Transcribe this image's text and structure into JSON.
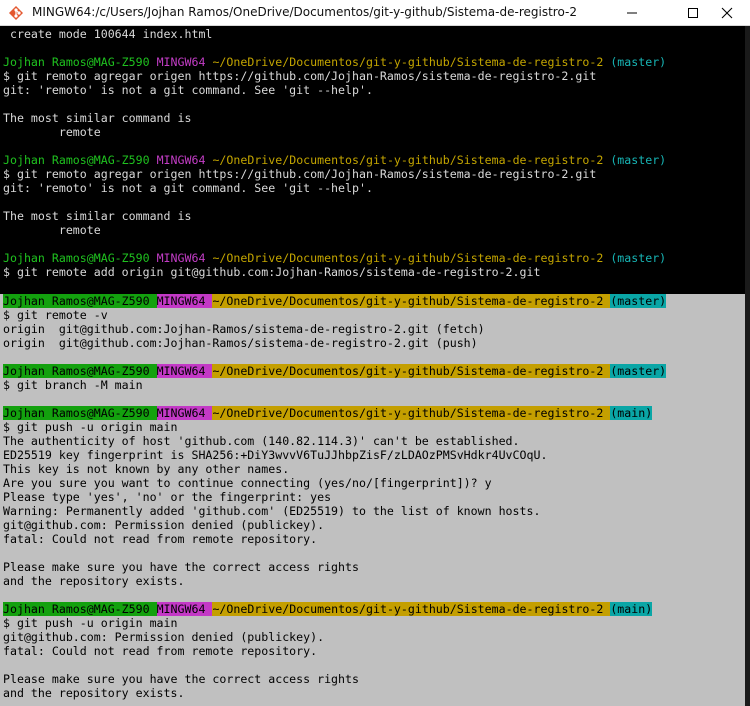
{
  "window": {
    "title": "MINGW64:/c/Users/Jojhan Ramos/OneDrive/Documentos/git-y-github/Sistema-de-registro-2"
  },
  "prompt": {
    "user": "Jojhan Ramos@MAG-Z590",
    "sys": "MINGW64",
    "path": "~/OneDrive/Documentos/git-y-github/Sistema-de-registro-2",
    "branch_master": "(master)",
    "branch_main": "(main)"
  },
  "lines": {
    "l0": " create mode 100644 index.html",
    "l2": "$ git remoto agregar origen https://github.com/Jojhan-Ramos/sistema-de-registro-2.git",
    "l3": "git: 'remoto' is not a git command. See 'git --help'.",
    "l5": "The most similar command is",
    "l6": "        remote",
    "l9": "$ git remoto agregar origen https://github.com/Jojhan-Ramos/sistema-de-registro-2.git",
    "l10": "git: 'remoto' is not a git command. See 'git --help'.",
    "l12": "The most similar command is",
    "l13": "        remote",
    "l16": "$ git remote add origin git@github.com:Jojhan-Ramos/sistema-de-registro-2.git",
    "l18": "$ git remote -v",
    "l19": "origin  git@github.com:Jojhan-Ramos/sistema-de-registro-2.git (fetch)",
    "l20": "origin  git@github.com:Jojhan-Ramos/sistema-de-registro-2.git (push)",
    "l23": "$ git branch -M main",
    "l26": "$ git push -u origin main",
    "l27": "The authenticity of host 'github.com (140.82.114.3)' can't be established.",
    "l28": "ED25519 key fingerprint is SHA256:+DiY3wvvV6TuJJhbpZisF/zLDAOzPMSvHdkr4UvCOqU.",
    "l29": "This key is not known by any other names.",
    "l30": "Are you sure you want to continue connecting (yes/no/[fingerprint])? y",
    "l31": "Please type 'yes', 'no' or the fingerprint: yes",
    "l32": "Warning: Permanently added 'github.com' (ED25519) to the list of known hosts.",
    "l33": "git@github.com: Permission denied (publickey).",
    "l34": "fatal: Could not read from remote repository.",
    "l36": "Please make sure you have the correct access rights",
    "l37": "and the repository exists.",
    "l40": "$ git push -u origin main",
    "l41": "git@github.com: Permission denied (publickey).",
    "l42": "fatal: Could not read from remote repository.",
    "l44": "Please make sure you have the correct access rights",
    "l45": "and the repository exists."
  },
  "icons": {
    "app": "git-bash-icon",
    "minimize": "minimize-icon",
    "maximize": "maximize-icon",
    "close": "close-icon"
  },
  "colors": {
    "prompt_user": "#13a10e",
    "prompt_sys": "#c339c6",
    "prompt_path": "#c49f00",
    "prompt_branch": "#0aa6a6",
    "selection_bg": "#c0c0c0"
  }
}
